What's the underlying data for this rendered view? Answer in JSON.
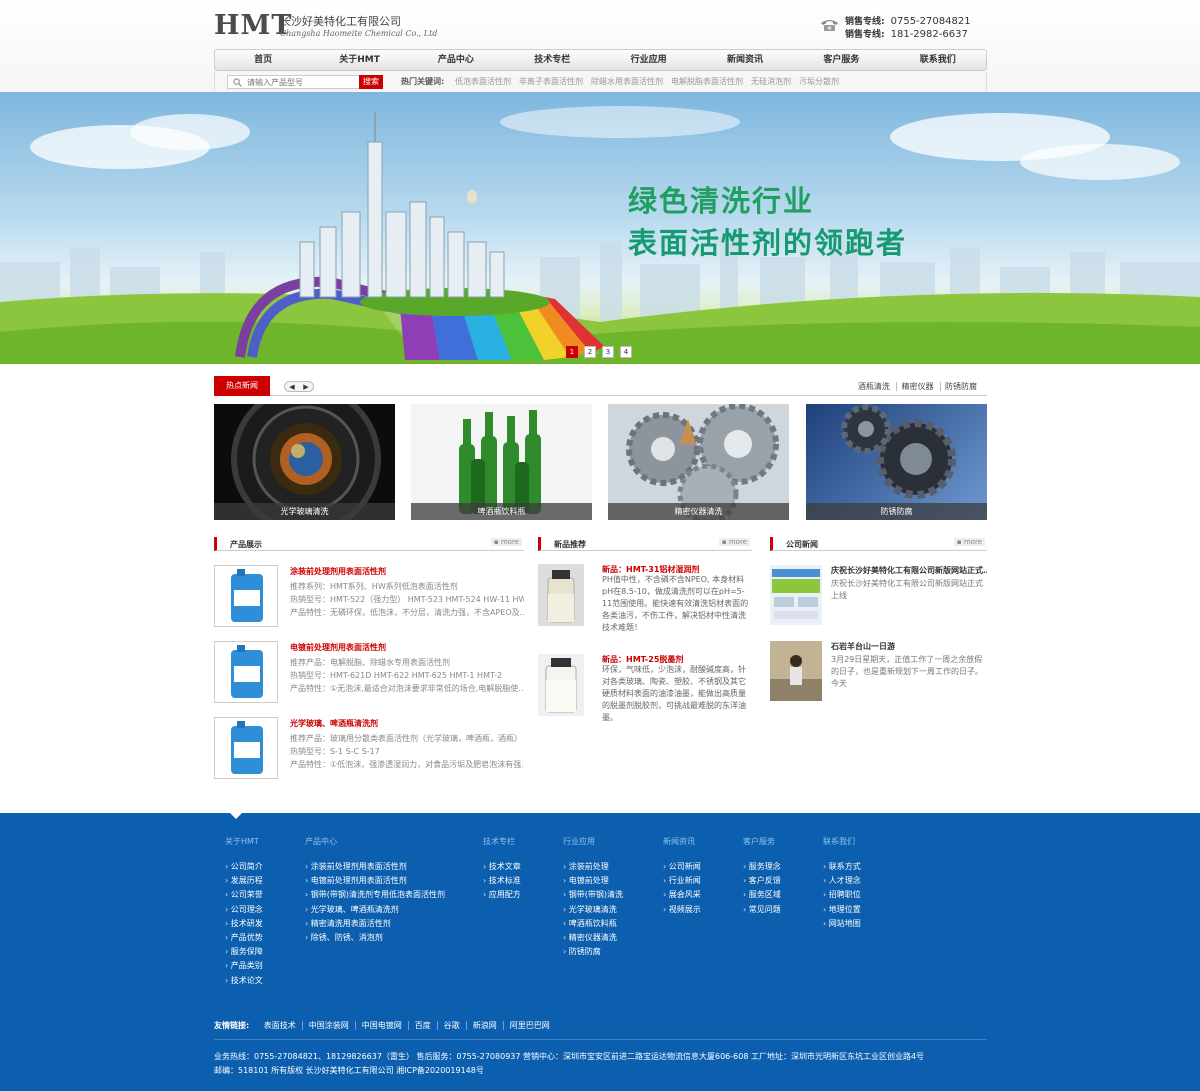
{
  "header": {
    "logo_mark": "HMT",
    "company_cn": "长沙好美特化工有限公司",
    "company_en": "Changsha Haomeite Chemical Co., Ltd",
    "sales_lines": [
      {
        "label": "销售专线:",
        "number": "0755-27084821"
      },
      {
        "label": "销售专线:",
        "number": "181-2982-6637"
      }
    ]
  },
  "nav": {
    "items": [
      "首页",
      "关于HMT",
      "产品中心",
      "技术专栏",
      "行业应用",
      "新闻资讯",
      "客户服务",
      "联系我们"
    ]
  },
  "search": {
    "placeholder": "请输入产品型号",
    "button": "搜索",
    "hot_label": "热门关键词:",
    "hot_keywords": [
      "低泡表面活性剂",
      "非离子表面活性剂",
      "除蜡水用表面活性剂",
      "电解脱脂表面活性剂",
      "无硅消泡剂",
      "污垢分散剂"
    ]
  },
  "banner": {
    "line1": "绿色清洗行业",
    "line2": "表面活性剂的领跑者",
    "dots": [
      "1",
      "2",
      "3",
      "4"
    ],
    "active_dot": 1
  },
  "hot_news": {
    "tab": "热点新闻",
    "tags": [
      "酒瓶清洗",
      "精密仪器",
      "防锈防腐"
    ],
    "photos": [
      "光学玻璃清洗",
      "啤酒瓶饮料瓶",
      "精密仪器清洗",
      "防锈防腐"
    ]
  },
  "products": {
    "title": "产品展示",
    "more": "more",
    "items": [
      {
        "name": "涂装前处理剂用表面活性剂",
        "l1": "推荐系列：HMT系列、HW系列低泡表面活性剂",
        "l2": "热销型号：HMT-522（强力型） HMT-523 HMT-524 HW-11 HW-9…",
        "l3": "产品特性：无磷环保，低泡沫，不分层，清洗力强，不含APEO及…"
      },
      {
        "name": "电镀前处理剂用表面活性剂",
        "l1": "推荐产品：电解脱脂、除蜡水专用表面活性剂",
        "l2": "热销型号：HMT-621D HMT-622 HMT-625 HMT-1 HMT-2",
        "l3": "产品特性：①无泡沫,最适合对泡沫要求非常低的场合,电解脱脂使…"
      },
      {
        "name": "光学玻璃、啤酒瓶清洗剂",
        "l1": "推荐产品：玻璃用分散类表面活性剂（光学玻璃，啤酒瓶，酒瓶）",
        "l2": "热销型号：S-1 S-C S-17",
        "l3": "产品特性：①低泡沫，强渗透湿润力，对食品污垢及肥皂泡沫有强…"
      }
    ]
  },
  "new_products": {
    "title": "新品推荐",
    "more": "more",
    "items": [
      {
        "title": "新品：HMT-31铝材湿润剂",
        "desc": "PH值中性，不含磷不含NPEO, 本身材料pH在8.5-10，做成清洗剂可以在pH=5-11范围使用。能快速有效清洗铝材表面的各类油污，不伤工件，解决铝材中性清洗技术难题！"
      },
      {
        "title": "新品：HMT-25脱墨剂",
        "desc": "环保，气味低，少泡沫，耐酸碱度高，针对各类玻璃、陶瓷、塑胶、不锈钢及其它硬质材料表面的油漆油墨，能做出高质量的脱墨剂脱胶剂，可挑战最难脱的东洋油墨。"
      }
    ]
  },
  "company_news": {
    "title": "公司新闻",
    "more": "more",
    "items": [
      {
        "title": "庆祝长沙好美特化工有限公司新版网站正式…",
        "desc": "庆祝长沙好美特化工有限公司新版网站正式上线"
      },
      {
        "title": "石岩羊台山一日游",
        "desc": "3月29日星期天，正值工作了一周之余放假的日子，也是重新规划下一周工作的日子。今天"
      }
    ]
  },
  "footer": {
    "columns": [
      {
        "head": "关于HMT",
        "items": [
          "公司简介",
          "发展历程",
          "公司荣誉",
          "公司理念",
          "技术研发",
          "产品优势",
          "服务保障",
          "产品类别",
          "技术论文"
        ]
      },
      {
        "head": "产品中心",
        "items": [
          "涂装前处理剂用表面活性剂",
          "电镀前处理剂用表面活性剂",
          "钢带(带钢)清洗剂专用低泡表面活性剂",
          "光学玻璃、啤酒瓶清洗剂",
          "精密清洗用表面活性剂",
          "除锈、防锈、消泡剂"
        ]
      },
      {
        "head": "技术专栏",
        "items": [
          "技术文章",
          "技术标准",
          "应用配方"
        ]
      },
      {
        "head": "行业应用",
        "items": [
          "涂装前处理",
          "电镀前处理",
          "钢带(带钢)清洗",
          "光学玻璃清洗",
          "啤酒瓶饮料瓶",
          "精密仪器清洗",
          "防锈防腐"
        ]
      },
      {
        "head": "新闻资讯",
        "items": [
          "公司新闻",
          "行业新闻",
          "展会风采",
          "视频展示"
        ]
      },
      {
        "head": "客户服务",
        "items": [
          "服务理念",
          "客户反馈",
          "服务区域",
          "常见问题"
        ]
      },
      {
        "head": "联系我们",
        "items": [
          "联系方式",
          "人才理念",
          "招聘职位",
          "地理位置",
          "网站地图"
        ]
      }
    ],
    "friend_label": "友情链接:",
    "friend_links": [
      "表面技术",
      "中国涂装网",
      "中国电镀网",
      "百度",
      "谷歌",
      "新浪网",
      "阿里巴巴网"
    ],
    "line1": "业务热线：0755-27084821、18129826637（雷生） 售后服务：0755-27080937 营销中心：深圳市宝安区前进二路宝运达物流信息大厦606-608 工厂地址：深圳市光明新区东坑工业区创业路4号",
    "line2": "邮编：518101 所有版权 长沙好美特化工有限公司    湘ICP备2020019148号"
  }
}
